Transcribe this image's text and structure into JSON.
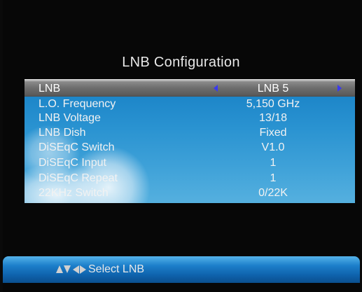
{
  "title": "LNB Configuration",
  "selected": {
    "label": "LNB",
    "value": "LNB 5",
    "left_icon": "arrow-left-icon",
    "right_icon": "arrow-right-icon"
  },
  "settings": [
    {
      "label": "L.O. Frequency",
      "value": "5,150 GHz"
    },
    {
      "label": "LNB Voltage",
      "value": "13/18"
    },
    {
      "label": "LNB Dish",
      "value": "Fixed"
    },
    {
      "label": "DiSEqC Switch",
      "value": "V1.0"
    },
    {
      "label": "DiSEqC Input",
      "value": "1"
    },
    {
      "label": "DiSEqC Repeat",
      "value": "1"
    },
    {
      "label": "22KHz Switch",
      "value": "0/22K"
    }
  ],
  "footer": {
    "hint": "Select LNB",
    "icons": [
      "up-arrow-icon",
      "down-arrow-icon",
      "left-arrow-icon",
      "right-arrow-icon"
    ]
  },
  "colors": {
    "accent": "#2a93d1",
    "selection_bar": "#6e6e6e",
    "arrow": "#3a3af0",
    "footer": "#1c7fca"
  }
}
